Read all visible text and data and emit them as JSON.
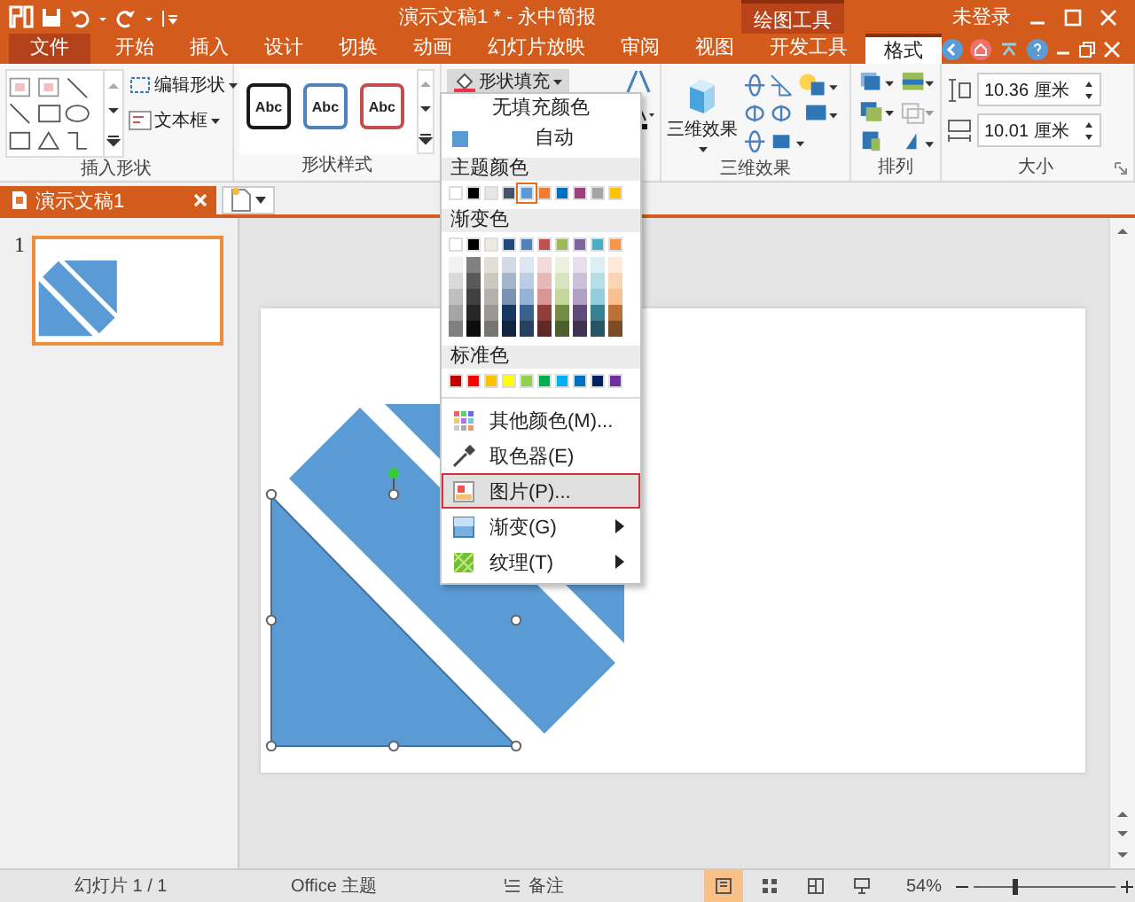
{
  "titlebar": {
    "title": "演示文稿1 * - 永中简报",
    "context_tab": "绘图工具",
    "account": "未登录"
  },
  "tabs": [
    {
      "label": "文件",
      "kind": "file",
      "selected": false
    },
    {
      "label": "开始",
      "kind": "normal",
      "selected": false
    },
    {
      "label": "插入",
      "kind": "normal",
      "selected": false
    },
    {
      "label": "设计",
      "kind": "normal",
      "selected": false
    },
    {
      "label": "切换",
      "kind": "normal",
      "selected": false
    },
    {
      "label": "动画",
      "kind": "normal",
      "selected": false
    },
    {
      "label": "幻灯片放映",
      "kind": "normal",
      "selected": false
    },
    {
      "label": "审阅",
      "kind": "normal",
      "selected": false
    },
    {
      "label": "视图",
      "kind": "normal",
      "selected": false
    },
    {
      "label": "开发工具",
      "kind": "normal",
      "selected": false
    },
    {
      "label": "格式",
      "kind": "context",
      "selected": true
    }
  ],
  "ribbon": {
    "insert_shapes": {
      "label": "插入形状",
      "edit_shape": "编辑形状",
      "text_box": "文本框"
    },
    "shape_styles": {
      "label": "形状样式",
      "styles": [
        {
          "text": "Abc",
          "color": "#1a1a1a"
        },
        {
          "text": "Abc",
          "color": "#4f81bd"
        },
        {
          "text": "Abc",
          "color": "#c0504d"
        }
      ]
    },
    "fill": {
      "button": "形状填充",
      "pressed": true
    },
    "effects_3d": {
      "button": "三维效果",
      "label": "三维效果"
    },
    "arrange": {
      "label": "排列"
    },
    "size": {
      "label": "大小",
      "height": "10.36 厘米",
      "width": "10.01 厘米"
    }
  },
  "doc_tabs": [
    {
      "title": "演示文稿1",
      "selected": true
    }
  ],
  "slides_panel": [
    {
      "number": "1",
      "selected": true
    }
  ],
  "shapes": [
    {
      "selected": true
    },
    {
      "selected": false
    },
    {
      "selected": false
    }
  ],
  "fill_menu": {
    "no_fill": "无填充颜色",
    "automatic": {
      "label": "自动",
      "color": "#5b9bd5"
    },
    "theme_header": "主题颜色",
    "theme_colors": [
      {
        "color": "#ffffff",
        "selected": false
      },
      {
        "color": "#000000",
        "selected": false
      },
      {
        "color": "#e7e6e6",
        "selected": false
      },
      {
        "color": "#44546a",
        "selected": false
      },
      {
        "color": "#5b9bd5",
        "selected": true
      },
      {
        "color": "#ed7d31",
        "selected": false
      },
      {
        "color": "#0070c0",
        "selected": false
      },
      {
        "color": "#9e3e7c",
        "selected": false
      },
      {
        "color": "#a5a5a5",
        "selected": false
      },
      {
        "color": "#ffc000",
        "selected": false
      }
    ],
    "gradient_header": "渐变色",
    "gradient_colors": [
      {
        "color": "#ffffff"
      },
      {
        "color": "#000000"
      },
      {
        "color": "#eeece1"
      },
      {
        "color": "#1f497d"
      },
      {
        "color": "#4f81bd"
      },
      {
        "color": "#c0504d"
      },
      {
        "color": "#9bbb59"
      },
      {
        "color": "#8064a2"
      },
      {
        "color": "#4bacc6"
      },
      {
        "color": "#f79646"
      }
    ],
    "standard_header": "标准色",
    "standard_colors": [
      {
        "color": "#c00000"
      },
      {
        "color": "#ff0000"
      },
      {
        "color": "#ffc000"
      },
      {
        "color": "#ffff00"
      },
      {
        "color": "#92d050"
      },
      {
        "color": "#00b050"
      },
      {
        "color": "#00b0f0"
      },
      {
        "color": "#0070c0"
      },
      {
        "color": "#002060"
      },
      {
        "color": "#7030a0"
      }
    ],
    "items": [
      {
        "label": "其他颜色(M)...",
        "selected": false,
        "submenu": false
      },
      {
        "label": "取色器(E)",
        "selected": false,
        "submenu": false
      },
      {
        "label": "图片(P)...",
        "selected": true,
        "submenu": false
      },
      {
        "label": "渐变(G)",
        "selected": false,
        "submenu": true
      },
      {
        "label": "纹理(T)",
        "selected": false,
        "submenu": true
      }
    ]
  },
  "status_bar": {
    "slide": "幻灯片 1 / 1",
    "theme": "Office 主题",
    "notes": "备注",
    "views": [
      {
        "selected": true
      },
      {
        "selected": false
      },
      {
        "selected": false
      },
      {
        "selected": false
      }
    ],
    "zoom": "54%",
    "zoom_slider": {
      "level": 0.28
    }
  }
}
